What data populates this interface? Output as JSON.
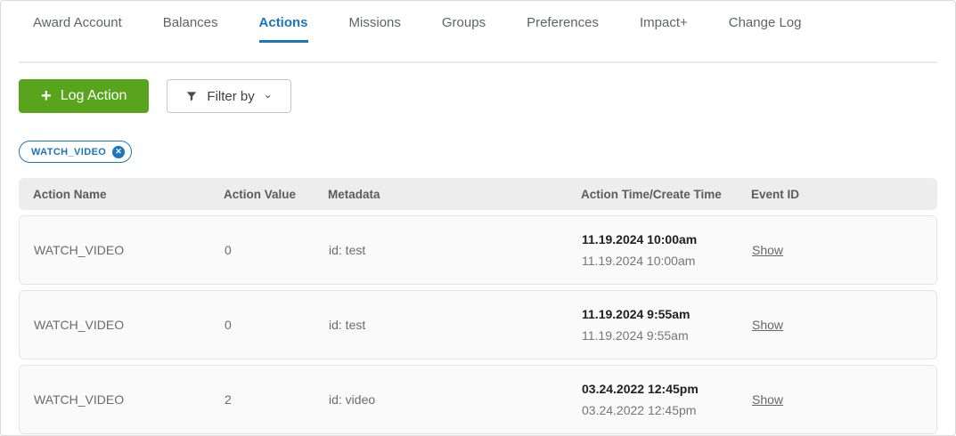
{
  "tabs": {
    "items": [
      {
        "label": "Award Account",
        "active": false
      },
      {
        "label": "Balances",
        "active": false
      },
      {
        "label": "Actions",
        "active": true
      },
      {
        "label": "Missions",
        "active": false
      },
      {
        "label": "Groups",
        "active": false
      },
      {
        "label": "Preferences",
        "active": false
      },
      {
        "label": "Impact+",
        "active": false
      },
      {
        "label": "Change Log",
        "active": false
      }
    ]
  },
  "toolbar": {
    "log_action_label": "Log Action",
    "plus_icon": "+",
    "filter_label": "Filter by",
    "chevron_icon": "⌄"
  },
  "filter_chip": {
    "label": "WATCH_VIDEO",
    "close_icon": "✕"
  },
  "table": {
    "columns": {
      "action_name": "Action Name",
      "action_value": "Action Value",
      "metadata": "Metadata",
      "action_time": "Action Time/Create Time",
      "event_id": "Event ID"
    },
    "rows": [
      {
        "action_name": "WATCH_VIDEO",
        "action_value": "0",
        "metadata": "id: test",
        "action_time": "11.19.2024 10:00am",
        "create_time": "11.19.2024 10:00am",
        "event_id_link": "Show"
      },
      {
        "action_name": "WATCH_VIDEO",
        "action_value": "0",
        "metadata": "id: test",
        "action_time": "11.19.2024 9:55am",
        "create_time": "11.19.2024 9:55am",
        "event_id_link": "Show"
      },
      {
        "action_name": "WATCH_VIDEO",
        "action_value": "2",
        "metadata": "id: video",
        "action_time": "03.24.2022 12:45pm",
        "create_time": "03.24.2022 12:45pm",
        "event_id_link": "Show"
      }
    ]
  },
  "colors": {
    "accent_blue": "#1b76bd",
    "accent_green": "#58a41d",
    "header_bg": "#ededed",
    "row_bg": "#fafafa"
  }
}
